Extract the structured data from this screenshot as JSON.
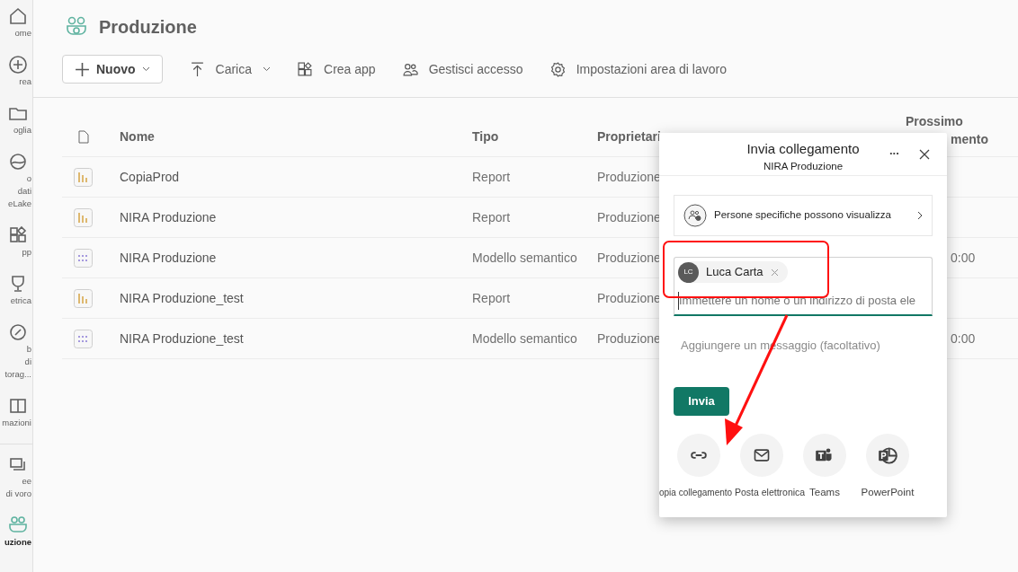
{
  "sidebar": {
    "items": [
      {
        "label": "ome",
        "selected": false
      },
      {
        "label": "rea",
        "selected": false
      },
      {
        "label": "oglia",
        "selected": false
      },
      {
        "label": "o dati eLake",
        "selected": false
      },
      {
        "label": "pp",
        "selected": false
      },
      {
        "label": "etrica",
        "selected": false
      },
      {
        "label": "b di torag...",
        "selected": false
      },
      {
        "label": "mazioni",
        "selected": false
      },
      {
        "label": "ee di voro",
        "selected": false
      },
      {
        "label": "uzione",
        "selected": true
      }
    ]
  },
  "workspace": {
    "title": "Produzione"
  },
  "toolbar": [
    {
      "label": "Nuovo",
      "dropdown": true,
      "kind": "primary"
    },
    {
      "label": "Carica",
      "dropdown": true,
      "kind": "plain"
    },
    {
      "label": "Crea app",
      "dropdown": false,
      "kind": "plain"
    },
    {
      "label": "Gestisci accesso",
      "dropdown": false,
      "kind": "plain"
    },
    {
      "label": "Impostazioni area di lavoro",
      "dropdown": false,
      "kind": "plain"
    }
  ],
  "table": {
    "columns": [
      "Nome",
      "Tipo",
      "Proprietari"
    ],
    "column_5": [
      "Prossimo",
      "mento"
    ],
    "rows": [
      {
        "kind": "report",
        "name": "CopiaProd",
        "type": "Report",
        "owner": "Produzione"
      },
      {
        "kind": "report",
        "name": "NIRA Produzione",
        "type": "Report",
        "owner": "Produzione"
      },
      {
        "kind": "model",
        "name": "NIRA Produzione",
        "type": "Modello semantico",
        "owner": "Produzione",
        "column_5": "0:00"
      },
      {
        "kind": "report",
        "name": "NIRA Produzione_test",
        "type": "Report",
        "owner": "Produzione"
      },
      {
        "kind": "model",
        "name": "NIRA Produzione_test",
        "type": "Modello semantico",
        "owner": "Produzione",
        "column_5": "0:00"
      }
    ]
  },
  "dialog": {
    "title": "Invia collegamento",
    "subtitle": "NIRA Produzione",
    "more": "...",
    "permission": "Persone specifiche possono visualizza",
    "recipients": [
      {
        "initials": "LC",
        "name": "Luca Carta"
      }
    ],
    "recipient_placeholder": "Immettere un nome o un indirizzo di posta ele",
    "message_placeholder": "Aggiungere un messaggio (facoltativo)",
    "send": "Invia",
    "share_options": [
      {
        "kind": "link",
        "label": "opia collegamento"
      },
      {
        "kind": "mail",
        "label": "Posta elettronica"
      },
      {
        "kind": "teams",
        "label": "Teams"
      },
      {
        "kind": "powerpoint",
        "label": "PowerPoint"
      }
    ]
  }
}
